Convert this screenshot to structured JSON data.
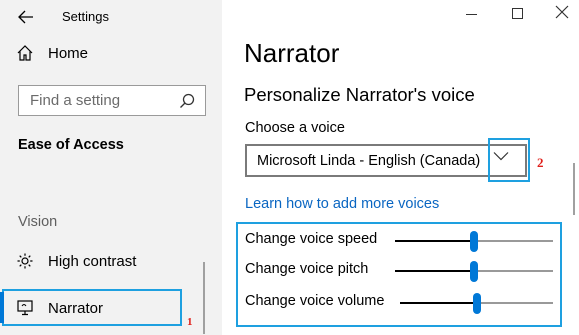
{
  "window": {
    "title": "Settings"
  },
  "sidebar": {
    "home_label": "Home",
    "search_placeholder": "Find a setting",
    "section_title": "Ease of Access",
    "group_label": "Vision",
    "items": [
      {
        "label": "High contrast",
        "icon": "sun-icon"
      },
      {
        "label": "Narrator",
        "icon": "narrator-icon",
        "selected": true
      }
    ]
  },
  "main": {
    "page_title": "Narrator",
    "subheading": "Personalize Narrator's voice",
    "choose_voice_label": "Choose a voice",
    "voice_selected": "Microsoft Linda - English (Canada)",
    "learn_more_link": "Learn how to add more voices",
    "sliders": [
      {
        "label": "Change voice speed",
        "value": 0.5
      },
      {
        "label": "Change voice pitch",
        "value": 0.5
      },
      {
        "label": "Change voice volume",
        "value": 0.5
      }
    ]
  },
  "annotations": {
    "marker_1": "1",
    "marker_2": "2",
    "highlight_color": "#1ea0e0",
    "marker_color": "#e0201b"
  },
  "colors": {
    "accent": "#0078d7",
    "link": "#0a66c2",
    "sidebar_bg": "#f2f2f2"
  }
}
